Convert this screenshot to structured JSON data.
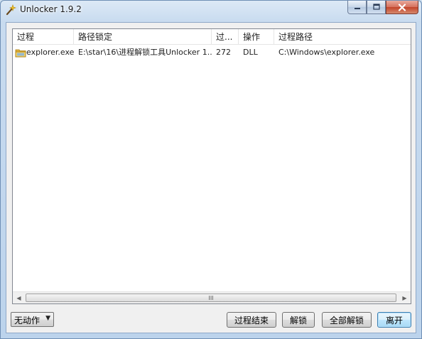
{
  "window": {
    "title": "Unlocker 1.9.2",
    "icons": {
      "app": "wand-icon",
      "minimize": "minimize-icon",
      "maximize": "maximize-icon",
      "close": "close-icon"
    }
  },
  "list": {
    "columns": [
      "过程",
      "路径锁定",
      "过...",
      "操作",
      "过程路径"
    ],
    "rows": [
      {
        "icon": "folder-icon",
        "process": "explorer.exe",
        "locked_path": "E:\\star\\16\\进程解锁工具Unlocker 1...",
        "pid": "272",
        "type": "DLL",
        "process_path": "C:\\Windows\\explorer.exe"
      }
    ],
    "scrollbar": {
      "left": "◀",
      "grip": "III",
      "right": "▶"
    }
  },
  "action_select": {
    "value": "无动作",
    "arrow": "▼"
  },
  "buttons": {
    "kill": "过程结束",
    "unlock": "解锁",
    "unlock_all": "全部解锁",
    "quit": "离开"
  },
  "colors": {
    "title_bar": "#c8dbef",
    "client": "#f0f0f0",
    "close": "#c2432a",
    "default_button": "#3c7fb1"
  }
}
